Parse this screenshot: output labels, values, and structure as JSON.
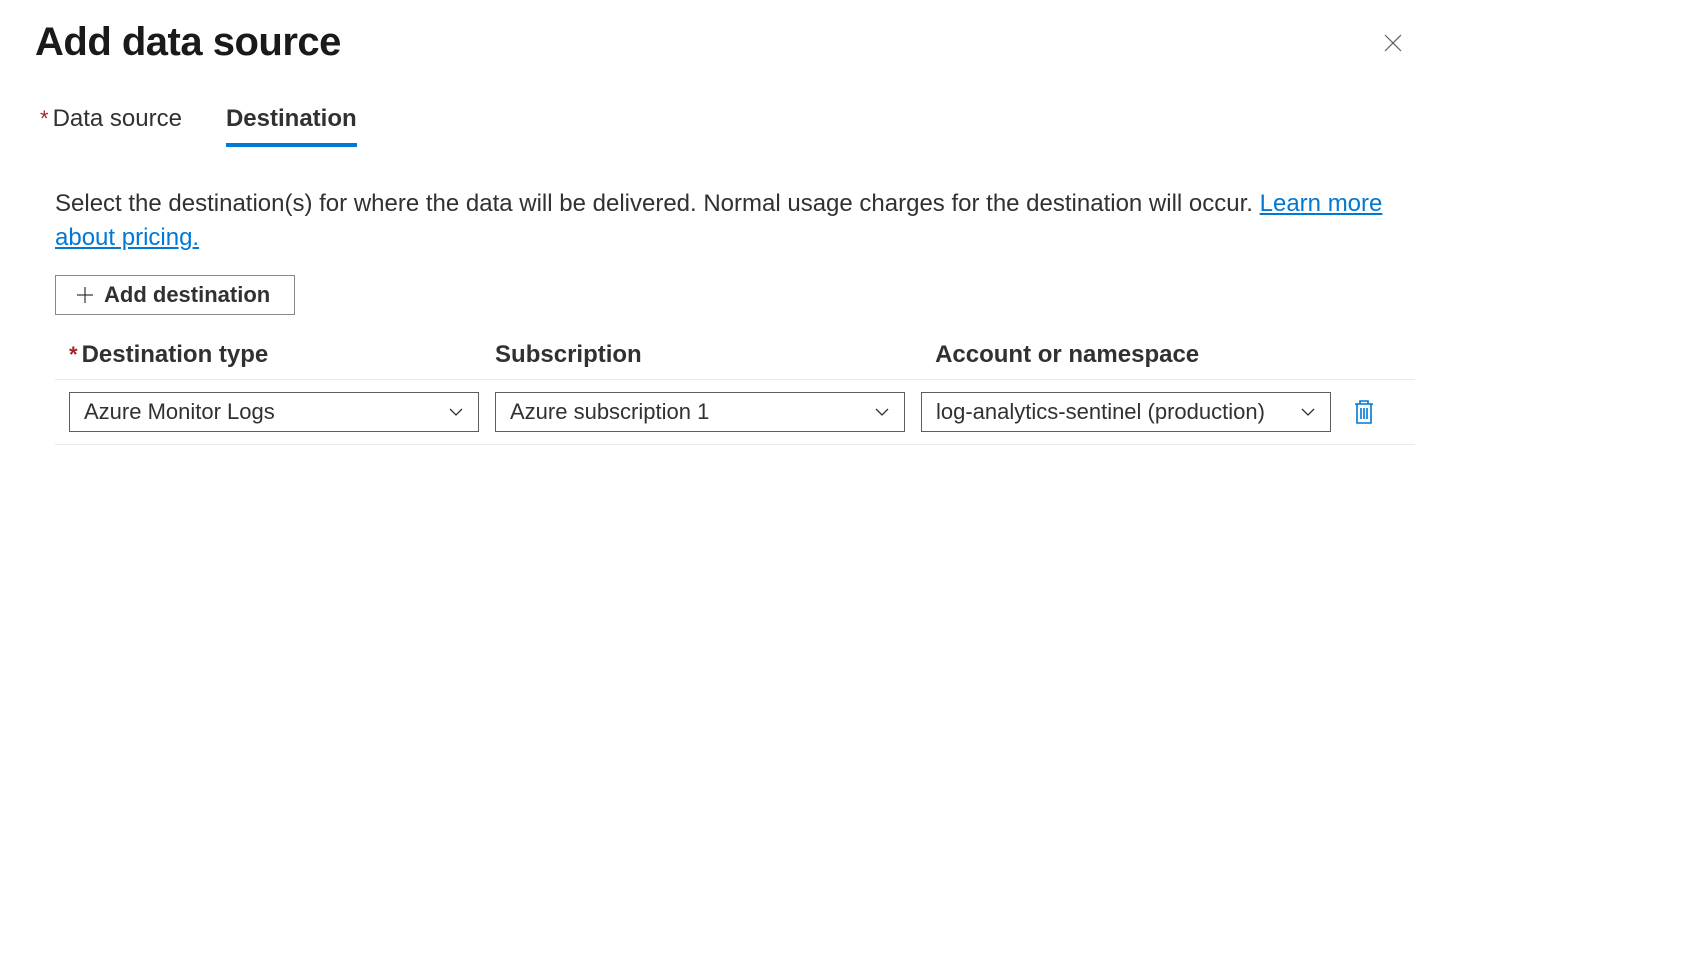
{
  "header": {
    "title": "Add data source"
  },
  "tabs": {
    "data_source": "Data source",
    "destination": "Destination"
  },
  "description": {
    "text_before_link": "Select the destination(s) for where the data will be delivered. Normal usage charges for the destination will occur. ",
    "link_text": "Learn more about pricing."
  },
  "buttons": {
    "add_destination": "Add destination"
  },
  "table": {
    "headers": {
      "destination_type": "Destination type",
      "subscription": "Subscription",
      "account_namespace": "Account or namespace"
    },
    "rows": [
      {
        "destination_type": "Azure Monitor Logs",
        "subscription": "Azure subscription 1",
        "account_namespace": "log-analytics-sentinel (production)"
      }
    ]
  }
}
